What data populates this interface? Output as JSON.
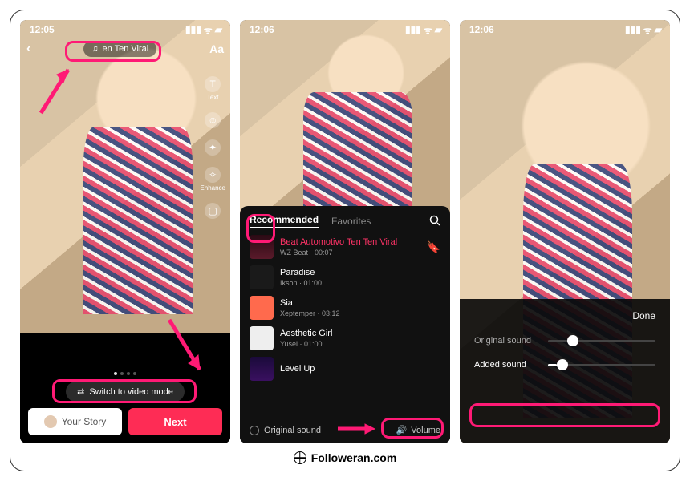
{
  "footer": {
    "text": "Followeran.com"
  },
  "status": {
    "time1": "12:05",
    "time2": "12:06",
    "time3": "12:06"
  },
  "panel1": {
    "sound_chip": "en Ten Viral",
    "tools": {
      "text": "Text",
      "enhance": "Enhance"
    },
    "switch_label": "Switch to video mode",
    "your_story": "Your Story",
    "next": "Next"
  },
  "panel2": {
    "tab_recommended": "Recommended",
    "tab_favorites": "Favorites",
    "songs": [
      {
        "title": "Beat Automotivo Ten Ten Viral",
        "artist": "WZ Beat · 00:07"
      },
      {
        "title": "Paradise",
        "artist": "Ikson · 01:00"
      },
      {
        "title": "Sia",
        "artist": "Xeptemper · 03:12"
      },
      {
        "title": "Aesthetic Girl",
        "artist": "Yusei · 01:00"
      },
      {
        "title": "Level Up",
        "artist": ""
      }
    ],
    "original_sound": "Original sound",
    "volume": "Volume"
  },
  "panel3": {
    "done": "Done",
    "original_label": "Original sound",
    "added_label": "Added sound",
    "original_pct": 18,
    "added_pct": 8
  }
}
